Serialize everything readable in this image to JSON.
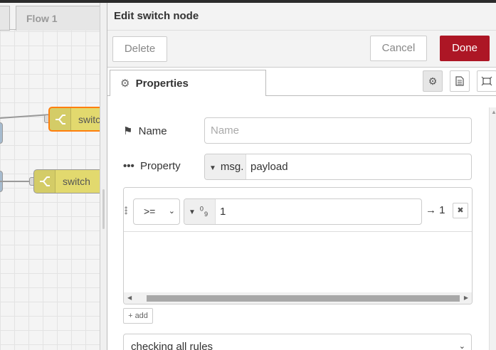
{
  "workspace": {
    "flow_tab_label": "Flow 1",
    "nodes": [
      {
        "label": "switch",
        "selected": true
      },
      {
        "label": "switch",
        "selected": false
      }
    ]
  },
  "tray": {
    "title": "Edit switch node",
    "buttons": {
      "delete": "Delete",
      "cancel": "Cancel",
      "done": "Done"
    },
    "tabs": {
      "properties": "Properties",
      "icons": [
        "gear-icon",
        "document-icon",
        "frame-icon"
      ]
    },
    "form": {
      "name": {
        "label": "Name",
        "value": "",
        "placeholder": "Name",
        "icon": "tag-icon"
      },
      "property": {
        "label": "Property",
        "icon": "ellipsis-icon",
        "type": "msg.",
        "value": "payload"
      },
      "rules": [
        {
          "operator": ">=",
          "value_type_icon": "number-icon",
          "value_type_text": "0 9",
          "value": "1",
          "output": "→ 1"
        }
      ],
      "add_label": "add",
      "mode": "checking all rules"
    }
  },
  "colors": {
    "primary_button": "#ad1625",
    "switch_node": "#e2d96e",
    "selected_outline": "#ff7f0e"
  }
}
